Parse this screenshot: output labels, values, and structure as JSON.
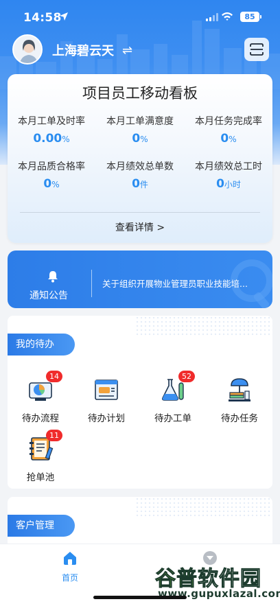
{
  "status_bar": {
    "time": "14:58",
    "battery": "85"
  },
  "header": {
    "org_name": "上海碧云天",
    "switch_symbol": "⇌"
  },
  "board": {
    "title": "项目员工移动看板",
    "metrics": [
      {
        "label": "本月工单及时率",
        "value": "0.00",
        "unit": "%"
      },
      {
        "label": "本月工单满意度",
        "value": "0",
        "unit": "%"
      },
      {
        "label": "本月任务完成率",
        "value": "0",
        "unit": "%"
      },
      {
        "label": "本月品质合格率",
        "value": "0",
        "unit": "%"
      },
      {
        "label": "本月绩效总单数",
        "value": "0",
        "unit": "件"
      },
      {
        "label": "本月绩效总工时",
        "value": "0",
        "unit": "小时"
      }
    ],
    "details_label": "查看详情 >"
  },
  "notice": {
    "label": "通知公告",
    "text": "关于组织开展物业管理员职业技能培..."
  },
  "todo": {
    "title": "我的待办",
    "items": [
      {
        "label": "待办流程",
        "badge": "14",
        "icon": "pie-chart-monitor-icon"
      },
      {
        "label": "待办计划",
        "badge": "",
        "icon": "plan-document-icon"
      },
      {
        "label": "待办工单",
        "badge": "52",
        "icon": "lab-flask-icon"
      },
      {
        "label": "待办任务",
        "badge": "",
        "icon": "desk-lamp-icon"
      },
      {
        "label": "抢单池",
        "badge": "11",
        "icon": "notebook-icon"
      }
    ]
  },
  "customer": {
    "title": "客户管理"
  },
  "tabbar": {
    "items": [
      {
        "label": "首页",
        "icon": "home-icon",
        "active": true
      },
      {
        "label": "",
        "icon": "chevron-circle-icon",
        "active": false
      }
    ],
    "active_color": "#2a8df0"
  },
  "watermark": {
    "main_prefix": "谷普",
    "main_rest": "软件园",
    "sub": "www.gupuxlazal.com"
  },
  "colors": {
    "brand": "#2f86f0",
    "badge": "#f02b2b",
    "value": "#2a8df0"
  }
}
